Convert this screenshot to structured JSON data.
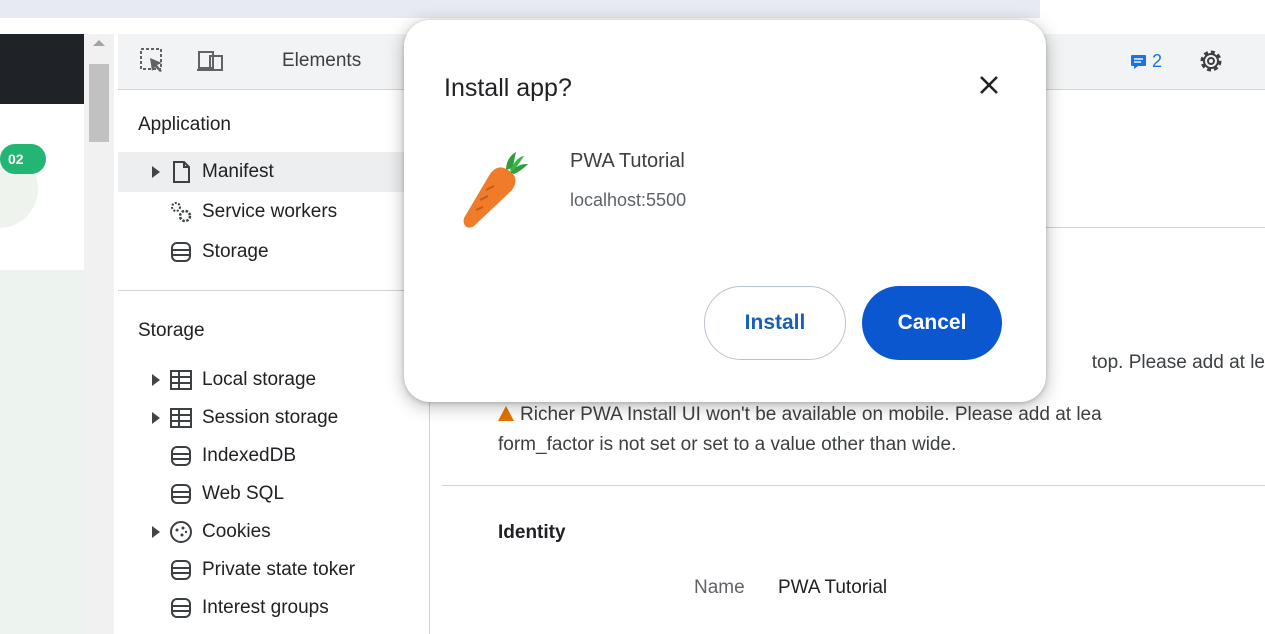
{
  "page": {
    "badge_text": "02"
  },
  "toolbar": {
    "inspect_icon": "inspect-element-icon",
    "device_icon": "device-toolbar-icon",
    "elements_tab": "Elements",
    "issues_count": "2",
    "settings_icon": "gear-icon"
  },
  "sidebar": {
    "application_heading": "Application",
    "application_items": [
      {
        "label": "Manifest",
        "icon": "document-icon",
        "expandable": true
      },
      {
        "label": "Service workers",
        "icon": "gears-icon",
        "expandable": false
      },
      {
        "label": "Storage",
        "icon": "database-icon",
        "expandable": false
      }
    ],
    "storage_heading": "Storage",
    "storage_items": [
      {
        "label": "Local storage",
        "icon": "table-icon",
        "expandable": true
      },
      {
        "label": "Session storage",
        "icon": "table-icon",
        "expandable": true
      },
      {
        "label": "IndexedDB",
        "icon": "database-icon",
        "expandable": false
      },
      {
        "label": "Web SQL",
        "icon": "database-icon",
        "expandable": false
      },
      {
        "label": "Cookies",
        "icon": "cookie-icon",
        "expandable": true
      },
      {
        "label": "Private state toker",
        "icon": "database-icon",
        "expandable": false
      },
      {
        "label": "Interest groups",
        "icon": "database-icon",
        "expandable": false
      }
    ]
  },
  "main": {
    "warning_fragment": "top. Please add at le",
    "warning_line_1": "Richer PWA Install UI won't be available on mobile. Please add at lea",
    "warning_line_2": "form_factor is not set or set to a value other than wide.",
    "identity_heading": "Identity",
    "name_label": "Name",
    "name_value": "PWA Tutorial"
  },
  "dialog": {
    "title": "Install app?",
    "close_icon": "close-icon",
    "app_icon": "carrot-icon",
    "app_name": "PWA Tutorial",
    "app_origin": "localhost:5500",
    "install_label": "Install",
    "cancel_label": "Cancel"
  },
  "colors": {
    "primary_button": "#0b57d0",
    "badge": "#22b573",
    "warning": "#e37400",
    "selected_row": "#eceef0"
  }
}
